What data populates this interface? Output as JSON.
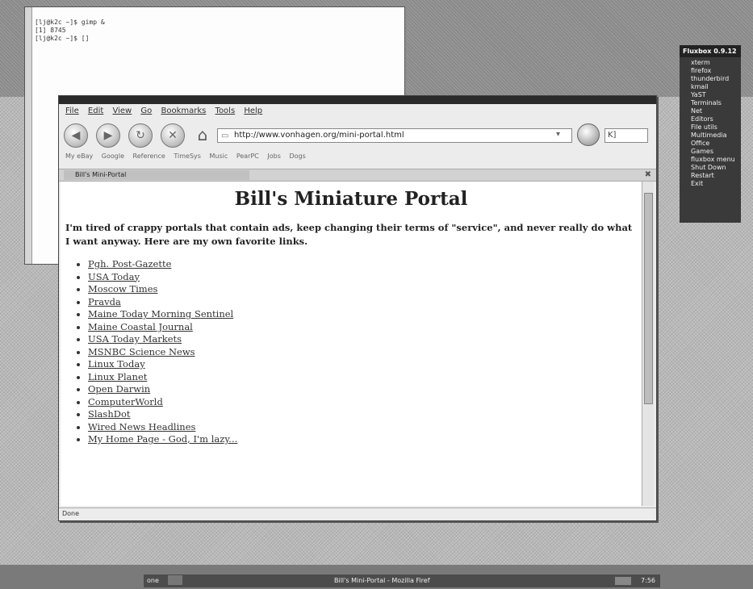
{
  "terminal": {
    "lines": [
      "[lj@k2c ~]$ gimp &",
      "[1] 8745",
      "[lj@k2c ~]$ []"
    ]
  },
  "fluxbox": {
    "title": "Fluxbox 0.9.12",
    "items": [
      "xterm",
      "firefox",
      "thunderbird",
      "kmail",
      "YaST",
      "Terminals",
      "Net",
      "Editors",
      "File utils",
      "Multimedia",
      "Office",
      "Games",
      "fluxbox menu",
      "Shut Down",
      "Restart",
      "Exit"
    ]
  },
  "browser": {
    "menus": [
      "File",
      "Edit",
      "View",
      "Go",
      "Bookmarks",
      "Tools",
      "Help"
    ],
    "url": "http://www.vonhagen.org/mini-portal.html",
    "search_placeholder": "K]",
    "bookmarks": [
      "My eBay",
      "Google",
      "Reference",
      "TimeSys",
      "Music",
      "PearPC",
      "Jobs",
      "Dogs"
    ],
    "tab_title": "Bill's Mini-Portal",
    "status": "Done"
  },
  "page": {
    "title": "Bill's Miniature Portal",
    "intro": "I'm tired of crappy portals that contain ads, keep changing their terms of \"service\", and never really do what I want anyway. Here are my own favorite links.",
    "links": [
      "Pgh. Post-Gazette",
      "USA Today",
      "Moscow Times",
      "Pravda",
      "Maine Today Morning Sentinel",
      "Maine Coastal Journal",
      "USA Today Markets",
      "MSNBC Science News",
      "Linux Today",
      "Linux Planet",
      "Open Darwin",
      "ComputerWorld",
      "SlashDot",
      "Wired News Headlines",
      "My Home Page - God, I'm lazy..."
    ]
  },
  "taskbar": {
    "workspace": "one",
    "task": "Bill's Mini-Portal - Mozilla Firef",
    "clock": "7:56"
  },
  "icons": {
    "back": "back-arrow-icon",
    "forward": "forward-arrow-icon",
    "reload": "reload-icon",
    "stop": "stop-icon",
    "home": "home-icon",
    "go": "go-icon"
  }
}
